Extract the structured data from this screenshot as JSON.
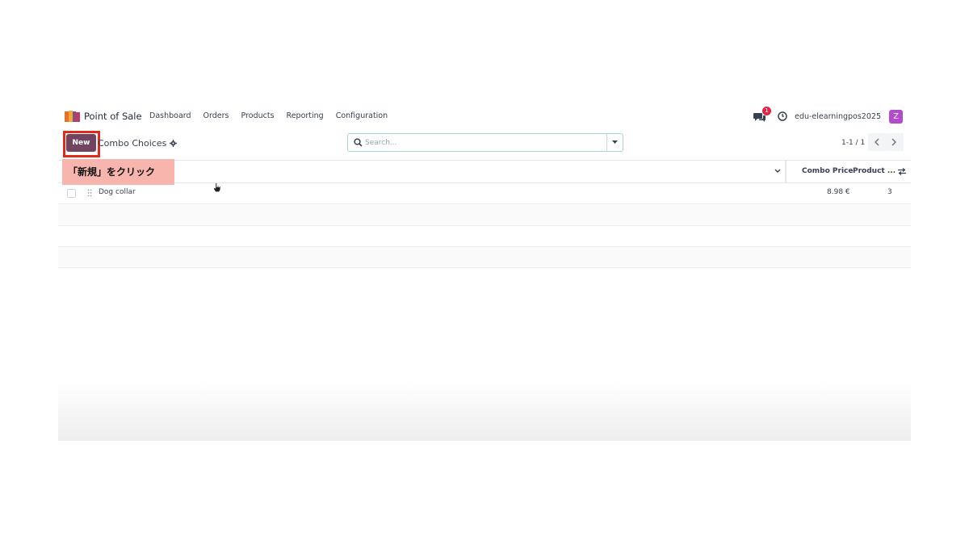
{
  "navbar": {
    "app_name": "Point of Sale",
    "menu": [
      "Dashboard",
      "Orders",
      "Products",
      "Reporting",
      "Configuration"
    ],
    "chat_badge": "1",
    "database": "edu-elearningpos2025",
    "avatar_letter": "Z"
  },
  "control": {
    "new_label": "New",
    "breadcrumb": "Combo Choices",
    "search_placeholder": "Search...",
    "pager": "1-1 / 1"
  },
  "annotation": "「新規」をクリック",
  "list": {
    "columns": {
      "combo_price": "Combo Price",
      "product": "Product ..."
    },
    "rows": [
      {
        "name": "Dog collar",
        "combo_price": "8.98 €",
        "product_count": "3"
      }
    ]
  },
  "colors": {
    "primary": "#71445f",
    "highlight_border": "#e02a1a",
    "annotation_bg": "#f7b5ad",
    "badge": "#dc2646",
    "avatar": "#b24bcf"
  }
}
